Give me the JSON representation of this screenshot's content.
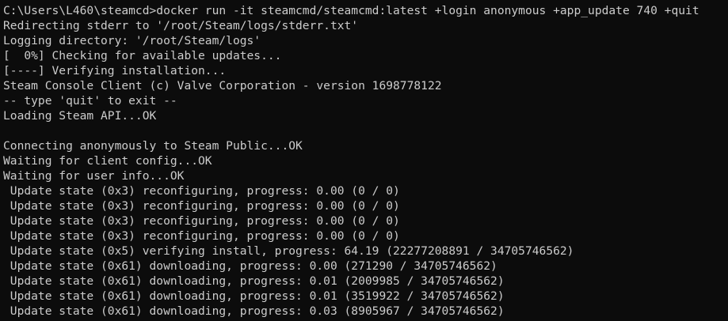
{
  "terminal": {
    "lines": [
      "C:\\Users\\L460\\steamcd>docker run -it steamcmd/steamcmd:latest +login anonymous +app_update 740 +quit",
      "Redirecting stderr to '/root/Steam/logs/stderr.txt'",
      "Logging directory: '/root/Steam/logs'",
      "[  0%] Checking for available updates...",
      "[----] Verifying installation...",
      "Steam Console Client (c) Valve Corporation - version 1698778122",
      "-- type 'quit' to exit --",
      "Loading Steam API...OK",
      "",
      "Connecting anonymously to Steam Public...OK",
      "Waiting for client config...OK",
      "Waiting for user info...OK",
      " Update state (0x3) reconfiguring, progress: 0.00 (0 / 0)",
      " Update state (0x3) reconfiguring, progress: 0.00 (0 / 0)",
      " Update state (0x3) reconfiguring, progress: 0.00 (0 / 0)",
      " Update state (0x3) reconfiguring, progress: 0.00 (0 / 0)",
      " Update state (0x5) verifying install, progress: 64.19 (22277208891 / 34705746562)",
      " Update state (0x61) downloading, progress: 0.00 (271290 / 34705746562)",
      " Update state (0x61) downloading, progress: 0.01 (2009985 / 34705746562)",
      " Update state (0x61) downloading, progress: 0.01 (3519922 / 34705746562)",
      " Update state (0x61) downloading, progress: 0.03 (8905967 / 34705746562)"
    ]
  }
}
